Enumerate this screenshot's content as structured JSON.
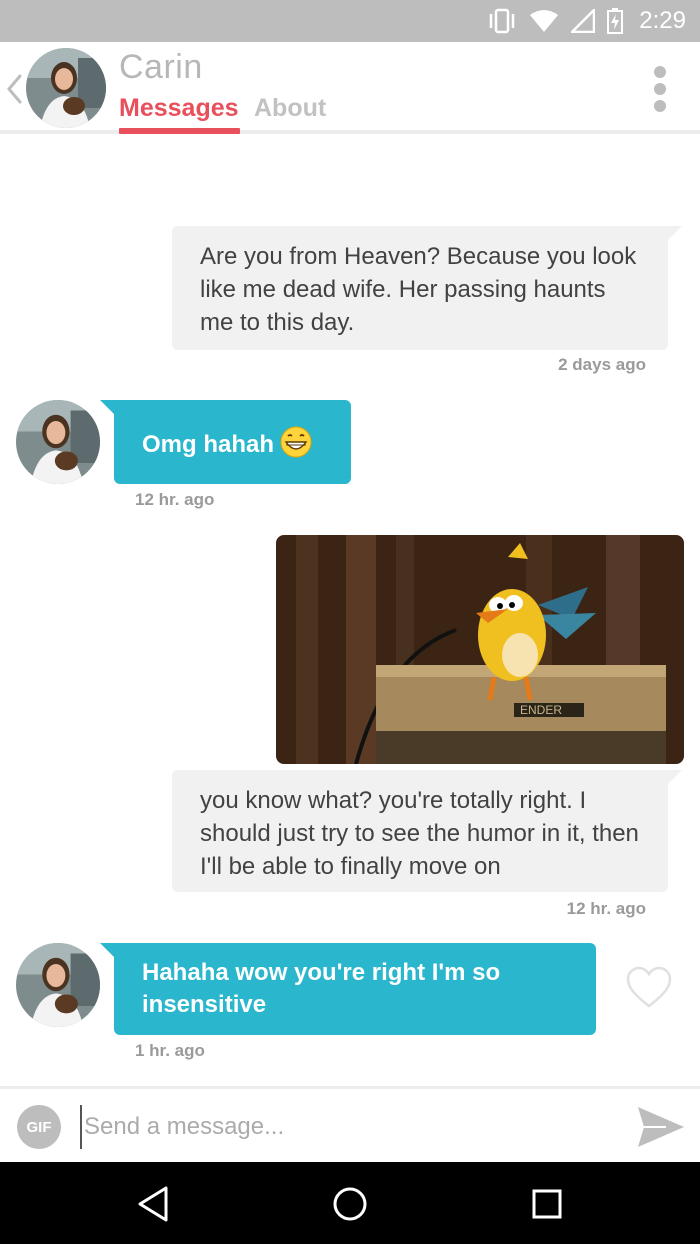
{
  "status_bar": {
    "time": "2:29",
    "icons": [
      "vibrate-icon",
      "wifi-icon",
      "signal-icon",
      "battery-charging-icon"
    ]
  },
  "header": {
    "contact_name": "Carin",
    "tabs": [
      {
        "label": "Messages",
        "active": true
      },
      {
        "label": "About",
        "active": false
      }
    ],
    "accent_color": "#e8505b"
  },
  "messages": [
    {
      "direction": "outgoing",
      "text": "Are you from Heaven? Because you look like me dead wife. Her passing haunts me to this day.",
      "timestamp": "2 days ago"
    },
    {
      "direction": "incoming",
      "text": "Omg hahah",
      "emoji": "grinning-face-icon",
      "timestamp": "12 hr. ago"
    },
    {
      "direction": "outgoing",
      "type": "gif",
      "image": "angry-bird-on-amp-gif",
      "image_text": "ENDER"
    },
    {
      "direction": "outgoing",
      "text": "you know what? you're totally right. I should just try to see the humor in it, then I'll be able to finally move on",
      "timestamp": "12 hr. ago"
    },
    {
      "direction": "incoming",
      "text": "Hahaha wow you're right I'm so insensitive",
      "timestamp": "1 hr. ago",
      "liked": false
    }
  ],
  "composer": {
    "gif_label": "GIF",
    "placeholder": "Send a message...",
    "value": ""
  },
  "colors": {
    "incoming_bubble": "#2ab6cc",
    "outgoing_bubble": "#f1f1f1"
  }
}
